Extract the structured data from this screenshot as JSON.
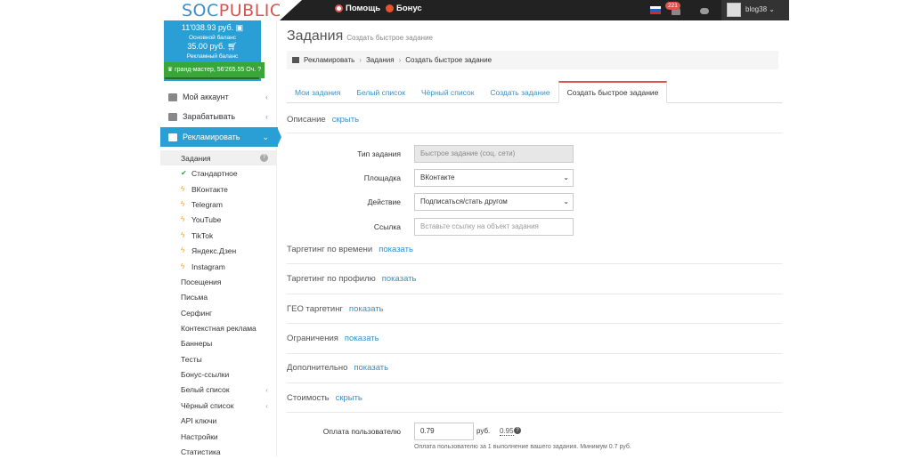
{
  "topbar": {
    "logo_part1": "SOC",
    "logo_part2": "PUBLIC",
    "help_label": "Помощь",
    "bonus_label": "Бонус",
    "notif_count": "221",
    "username": "blog38",
    "colors": {
      "bar": "#222222",
      "accent": "#2a9fd6",
      "logo_blue": "#3a8fc7",
      "logo_red": "#d9534f"
    }
  },
  "balance": {
    "main_amount": "11'038.93 руб.",
    "main_label": "Основной баланс",
    "ad_amount": "35.00 руб.",
    "ad_label": "Рекламный баланс",
    "rank": "гранд-мастер, 56'265.55 Оч."
  },
  "sidebar": {
    "items": [
      {
        "label": "Мой аккаунт",
        "icon": "home-icon"
      },
      {
        "label": "Зарабатывать",
        "icon": "briefcase-icon"
      },
      {
        "label": "Рекламировать",
        "icon": "chart-icon"
      }
    ],
    "sub": {
      "tasks": "Задания",
      "tasks_children": [
        "Стандартное",
        "ВКонтакте",
        "Telegram",
        "YouTube",
        "TikTok",
        "Яндекс.Дзен",
        "Instagram"
      ],
      "other": [
        "Посещения",
        "Письма",
        "Серфинг",
        "Контекстная реклама",
        "Баннеры",
        "Тесты",
        "Бонус-ссылки",
        "Белый список",
        "Чёрный список",
        "API ключи",
        "Настройки",
        "Статистика"
      ]
    }
  },
  "main": {
    "title": "Задания",
    "subtitle": "Создать быстрое задание",
    "breadcrumb": [
      "Рекламировать",
      "Задания",
      "Создать быстрое задание"
    ],
    "tabs": [
      "Мои задания",
      "Белый список",
      "Чёрный список",
      "Создать задание",
      "Создать быстрое задание"
    ],
    "sections": {
      "description": "Описание",
      "hide": "скрыть",
      "show": "показать",
      "time_targeting": "Таргетинг по времени",
      "profile_targeting": "Таргетинг по профилю",
      "geo_targeting": "ГЕО таргетинг",
      "limits": "Ограничения",
      "extra": "Дополнительно",
      "cost": "Стоимость"
    },
    "form": {
      "type_label": "Тип задания",
      "type_value": "Быстрое задание (соц. сети)",
      "platform_label": "Площадка",
      "platform_value": "ВКонтакте",
      "action_label": "Действие",
      "action_value": "Подписаться/стать другом",
      "link_label": "Ссылка",
      "link_placeholder": "Вставьте ссылку на объект задания",
      "pay_label": "Оплата пользователю",
      "pay_value": "0.79",
      "currency": "руб.",
      "pay_min": "0.95",
      "pay_help": "Оплата пользователю за 1 выполнение вашего задания. Минимум 0.7 руб."
    }
  }
}
